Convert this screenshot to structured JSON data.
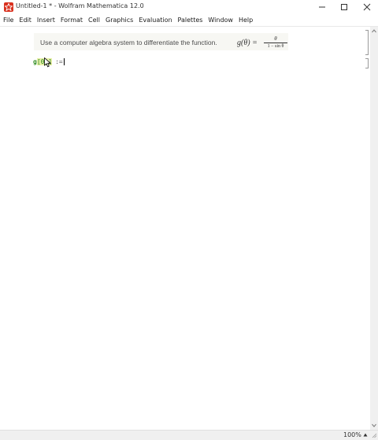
{
  "window": {
    "title": "Untitled-1 * - Wolfram Mathematica 12.0",
    "minimize_icon": "minimize-icon",
    "maximize_icon": "maximize-icon",
    "close_icon": "close-icon",
    "app_icon": "mathematica-icon"
  },
  "menu": [
    "File",
    "Edit",
    "Insert",
    "Format",
    "Cell",
    "Graphics",
    "Evaluation",
    "Palettes",
    "Window",
    "Help"
  ],
  "notebook": {
    "text_cell": "Use a computer algebra system to differentiate the function.",
    "formula_lhs": "g(θ) =",
    "formula_num": "θ",
    "formula_den": "1 − sin θ",
    "input_func": "g",
    "input_arg": "[θ_]",
    "input_op": ":=",
    "cell_bracket_style": "gray"
  },
  "status": {
    "zoom": "100%"
  },
  "colors": {
    "app_icon": "#d9311f",
    "text_cell_bg": "#f7f7f3",
    "input_green": "#2e8b1f",
    "selection_yellow": "#e9f0a8"
  }
}
